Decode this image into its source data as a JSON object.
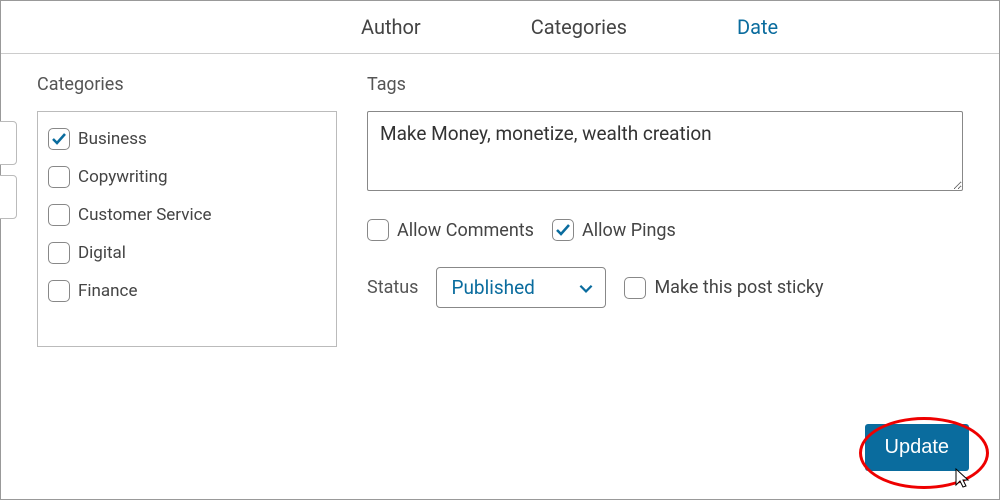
{
  "tabs": {
    "author": "Author",
    "categories": "Categories",
    "date": "Date"
  },
  "categories": {
    "label": "Categories",
    "items": [
      {
        "label": "Business",
        "checked": true
      },
      {
        "label": "Copywriting",
        "checked": false
      },
      {
        "label": "Customer Service",
        "checked": false
      },
      {
        "label": "Digital",
        "checked": false
      },
      {
        "label": "Finance",
        "checked": false
      }
    ]
  },
  "tags": {
    "label": "Tags",
    "value": "Make Money, monetize, wealth creation"
  },
  "options": {
    "allow_comments": {
      "label": "Allow Comments",
      "checked": false
    },
    "allow_pings": {
      "label": "Allow Pings",
      "checked": true
    },
    "status_label": "Status",
    "status_value": "Published",
    "sticky": {
      "label": "Make this post sticky",
      "checked": false
    }
  },
  "buttons": {
    "update": "Update"
  }
}
